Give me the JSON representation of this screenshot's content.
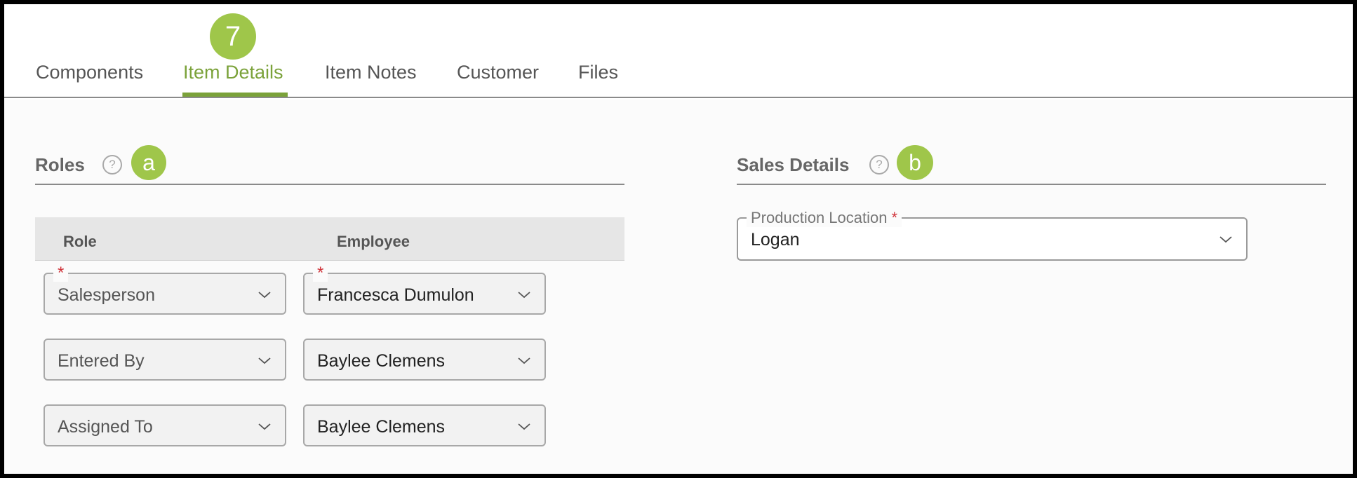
{
  "tabs": [
    {
      "label": "Components",
      "active": false
    },
    {
      "label": "Item Details",
      "active": true
    },
    {
      "label": "Item Notes",
      "active": false
    },
    {
      "label": "Customer",
      "active": false
    },
    {
      "label": "Files",
      "active": false
    }
  ],
  "annotations": {
    "step": "7",
    "roles": "a",
    "sales": "b"
  },
  "roles": {
    "title": "Roles",
    "help_icon": "?",
    "columns": {
      "role": "Role",
      "employee": "Employee"
    },
    "rows": [
      {
        "role": "Salesperson",
        "employee": "Francesca Dumulon",
        "required": "*"
      },
      {
        "role": "Entered By",
        "employee": "Baylee Clemens"
      },
      {
        "role": "Assigned To",
        "employee": "Baylee Clemens"
      }
    ]
  },
  "sales_details": {
    "title": "Sales Details",
    "help_icon": "?",
    "production_location": {
      "label": "Production Location",
      "required": "*",
      "value": "Logan"
    }
  },
  "colors": {
    "accent": "#7ba23a",
    "badge": "#9fc64a",
    "required": "#d0333a"
  },
  "icons": [
    "help-circle-icon",
    "chevron-down-icon"
  ]
}
